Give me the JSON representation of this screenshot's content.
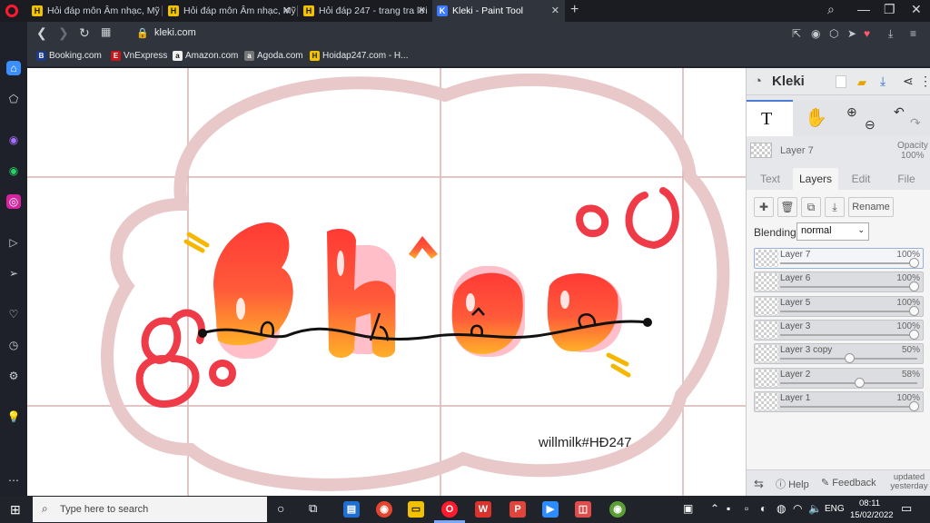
{
  "browser": {
    "tabs": [
      {
        "label": "Hỏi đáp môn Âm nhạc, Mỹ",
        "favicon": "H",
        "active": false
      },
      {
        "label": "Hỏi đáp môn Âm nhạc, Mỹ",
        "favicon": "H",
        "active": false
      },
      {
        "label": "Hỏi đáp 247 - trang tra lời",
        "favicon": "H",
        "active": false
      },
      {
        "label": "Kleki - Paint Tool",
        "favicon": "K",
        "active": true
      }
    ],
    "url": "kleki.com",
    "bookmarks": [
      {
        "label": "Booking.com",
        "icon": "B",
        "color": "#1d3a8a"
      },
      {
        "label": "VnExpress",
        "icon": "E",
        "color": "#c4161c"
      },
      {
        "label": "Amazon.com",
        "icon": "a",
        "color": "#f0f0f0"
      },
      {
        "label": "Agoda.com",
        "icon": "a",
        "color": "#777777"
      },
      {
        "label": "Hoidap247.com - H...",
        "icon": "H",
        "color": "#f2c200"
      }
    ]
  },
  "canvas": {
    "title_word": "rhế",
    "signature": "willmilk#HĐ247"
  },
  "kleki": {
    "app_name": "Kleki",
    "current_layer": "Layer 7",
    "opacity_label": "Opacity",
    "opacity_value": "100%",
    "tabs": [
      "Text",
      "Layers",
      "Edit",
      "File"
    ],
    "active_tab": "Layers",
    "rename_label": "Rename",
    "blending_label": "Blending",
    "blending_value": "normal",
    "layers": [
      {
        "name": "Layer 7",
        "opacity": "100%",
        "fraction": 1.0,
        "selected": true
      },
      {
        "name": "Layer 6",
        "opacity": "100%",
        "fraction": 1.0,
        "selected": false
      },
      {
        "name": "Layer 5",
        "opacity": "100%",
        "fraction": 1.0,
        "selected": false
      },
      {
        "name": "Layer 3",
        "opacity": "100%",
        "fraction": 1.0,
        "selected": false
      },
      {
        "name": "Layer 3 copy",
        "opacity": "50%",
        "fraction": 0.5,
        "selected": false
      },
      {
        "name": "Layer 2",
        "opacity": "58%",
        "fraction": 0.58,
        "selected": false
      },
      {
        "name": "Layer 1",
        "opacity": "100%",
        "fraction": 1.0,
        "selected": false
      }
    ],
    "footer": {
      "help": "Help",
      "feedback": "Feedback",
      "updated": "updated yesterday"
    }
  },
  "taskbar": {
    "search_placeholder": "Type here to search",
    "lang": "ENG",
    "time": "08:11",
    "date": "15/02/2022"
  }
}
